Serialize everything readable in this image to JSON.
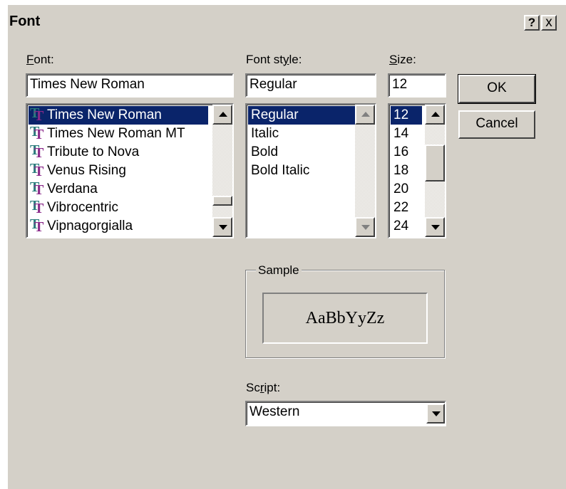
{
  "dialog": {
    "title": "Font",
    "help_button": "?",
    "close_button": "x"
  },
  "font": {
    "label_underline": "F",
    "label_rest": "ont:",
    "value": "Times New Roman",
    "items": [
      "Times New Roman",
      "Times New Roman MT",
      "Tribute to Nova",
      "Venus Rising",
      "Verdana",
      "Vibrocentric",
      "Vipnagorgialla"
    ],
    "selected": "Times New Roman",
    "item_icon": "truetype-icon"
  },
  "style": {
    "label_before": "Font st",
    "label_underline": "y",
    "label_after": "le:",
    "value": "Regular",
    "items": [
      "Regular",
      "Italic",
      "Bold",
      "Bold Italic"
    ],
    "selected": "Regular"
  },
  "size": {
    "label_underline": "S",
    "label_rest": "ize:",
    "value": "12",
    "items": [
      "12",
      "14",
      "16",
      "18",
      "20",
      "22",
      "24"
    ],
    "selected": "12"
  },
  "buttons": {
    "ok": "OK",
    "cancel": "Cancel"
  },
  "sample": {
    "legend": "Sample",
    "text": "AaBbYyZz"
  },
  "script": {
    "label_before": "Sc",
    "label_underline": "r",
    "label_after": "ipt:",
    "value": "Western"
  },
  "colors": {
    "face": "#d4d0c8",
    "selection": "#0a246a",
    "icon_teal": "#2a7c7c",
    "icon_purple": "#8a2a8a"
  }
}
